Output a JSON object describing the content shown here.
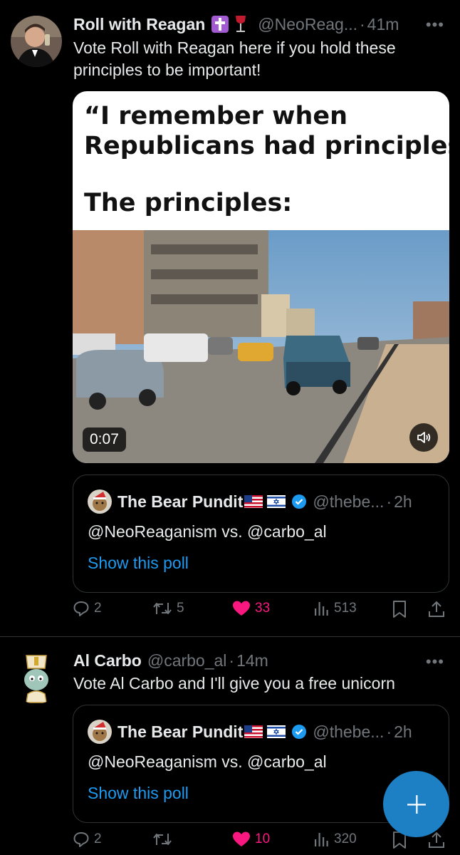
{
  "tweet1": {
    "name": "Roll with Reagan",
    "handle": "@NeoReag...",
    "time": "41m",
    "text": "Vote Roll with Reagan here if you hold these principles to be important!",
    "media": {
      "caption_line1": "“I remember when",
      "caption_line2": "Republicans had principles”",
      "caption_line3": "The principles:",
      "duration": "0:07"
    },
    "quote": {
      "name": "The Bear Pundit",
      "handle": "@thebe...",
      "time": "2h",
      "text": "@NeoReaganism vs. @carbo_al",
      "link": "Show this poll"
    },
    "actions": {
      "replies": "2",
      "reposts": "5",
      "likes": "33",
      "views": "513"
    }
  },
  "tweet2": {
    "name": "Al Carbo",
    "handle": "@carbo_al",
    "time": "14m",
    "text": "Vote Al Carbo and I'll give you a free unicorn",
    "quote": {
      "name": "The Bear Pundit",
      "handle": "@thebe...",
      "time": "2h",
      "text": "@NeoReaganism vs. @carbo_al",
      "link": "Show this poll"
    },
    "actions": {
      "replies": "2",
      "reposts": "",
      "likes": "10",
      "views": "320"
    }
  },
  "separator": "·",
  "more_label": "•••",
  "colors": {
    "accent": "#1d9bf0",
    "like": "#f91880",
    "muted": "#71767b",
    "fab": "#1d7fc4"
  },
  "icons": [
    "cross-badge-icon",
    "wine-glass-icon",
    "us-flag-icon",
    "israel-flag-icon",
    "verified-icon",
    "reply-icon",
    "repost-icon",
    "heart-icon",
    "views-icon",
    "bookmark-icon",
    "share-icon",
    "volume-icon",
    "plus-icon"
  ]
}
